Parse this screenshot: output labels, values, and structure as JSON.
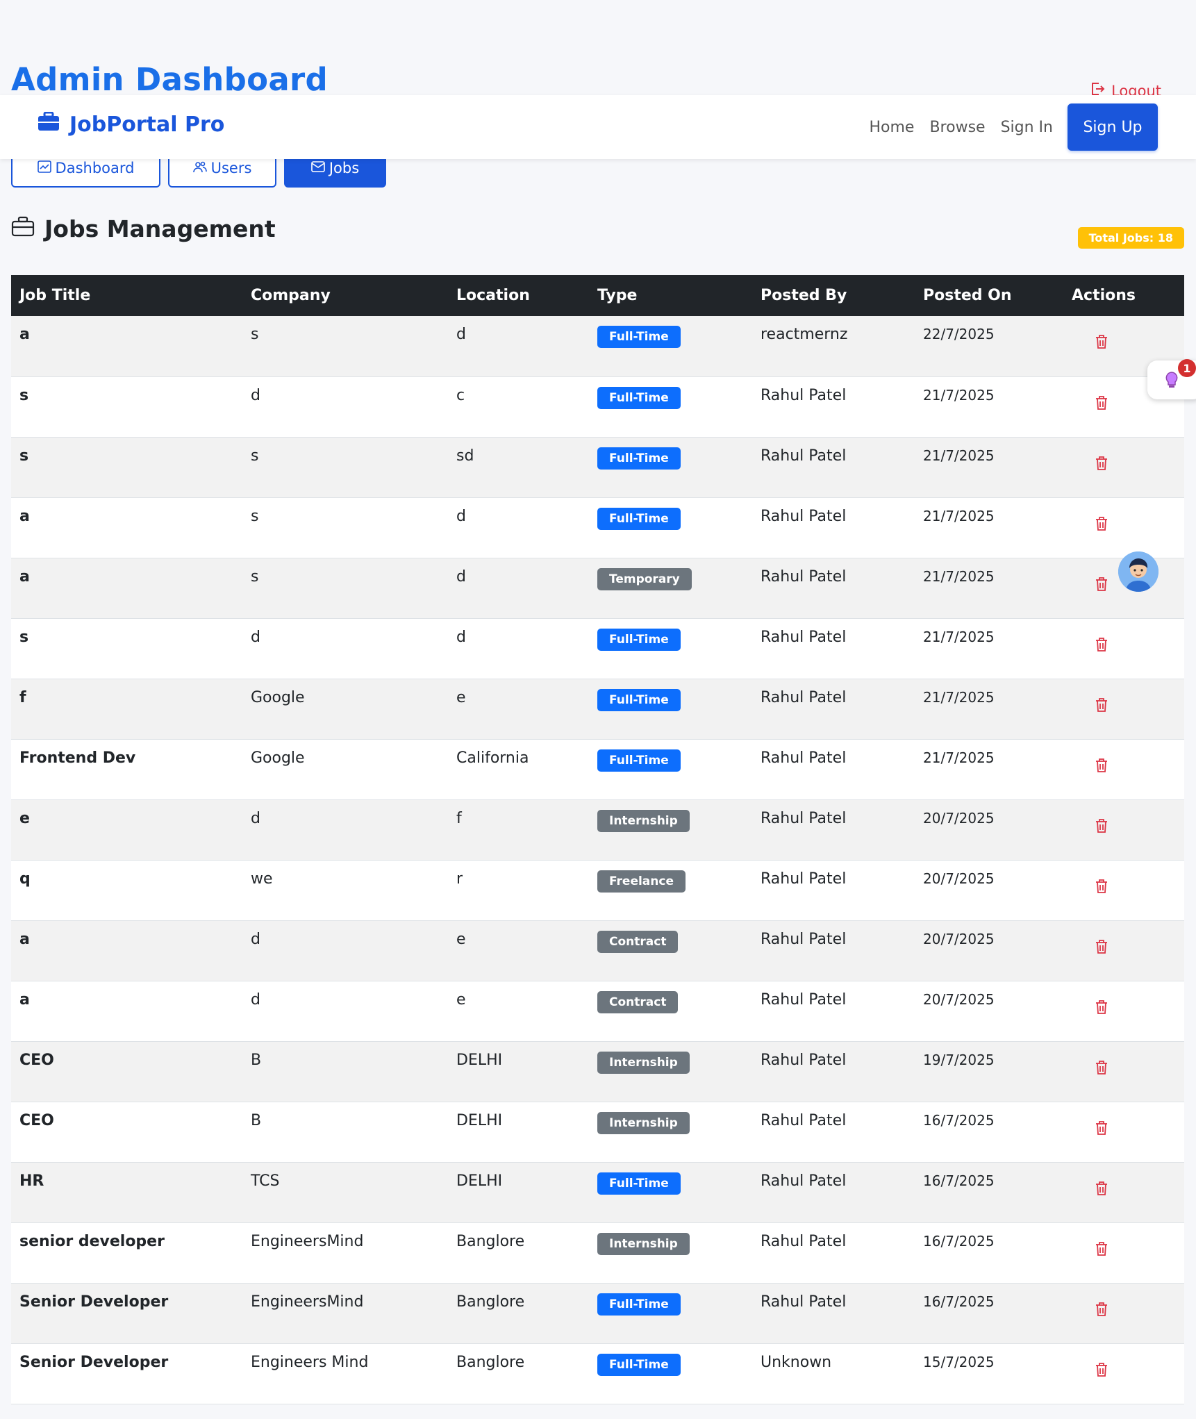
{
  "page": {
    "title": "Admin Dashboard",
    "logout_label": "Logout"
  },
  "navbar": {
    "brand": "JobPortal Pro",
    "links": [
      "Home",
      "Browse",
      "Sign In"
    ],
    "signup_label": "Sign Up"
  },
  "tabs": {
    "dashboard": "Dashboard",
    "users": "Users",
    "jobs": "Jobs"
  },
  "section": {
    "title": "Jobs Management",
    "total_badge": "Total Jobs: 18"
  },
  "floating": {
    "notification_count": "1"
  },
  "colors": {
    "primary": "#1a56db",
    "title_blue": "#1a6fe8",
    "danger": "#dc3545",
    "warning": "#ffc107",
    "badge_blue": "#0d6efd",
    "badge_gray": "#6c757d",
    "table_header": "#212529"
  },
  "table": {
    "headers": [
      "Job Title",
      "Company",
      "Location",
      "Type",
      "Posted By",
      "Posted On",
      "Actions"
    ],
    "rows": [
      {
        "title": "a",
        "company": "s",
        "location": "d",
        "type": "Full-Time",
        "posted_by": "reactmernz",
        "posted_on": "22/7/2025"
      },
      {
        "title": "s",
        "company": "d",
        "location": "c",
        "type": "Full-Time",
        "posted_by": "Rahul Patel",
        "posted_on": "21/7/2025"
      },
      {
        "title": "s",
        "company": "s",
        "location": "sd",
        "type": "Full-Time",
        "posted_by": "Rahul Patel",
        "posted_on": "21/7/2025"
      },
      {
        "title": "a",
        "company": "s",
        "location": "d",
        "type": "Full-Time",
        "posted_by": "Rahul Patel",
        "posted_on": "21/7/2025"
      },
      {
        "title": "a",
        "company": "s",
        "location": "d",
        "type": "Temporary",
        "posted_by": "Rahul Patel",
        "posted_on": "21/7/2025"
      },
      {
        "title": "s",
        "company": "d",
        "location": "d",
        "type": "Full-Time",
        "posted_by": "Rahul Patel",
        "posted_on": "21/7/2025"
      },
      {
        "title": "f",
        "company": "Google",
        "location": "e",
        "type": "Full-Time",
        "posted_by": "Rahul Patel",
        "posted_on": "21/7/2025"
      },
      {
        "title": "Frontend Dev",
        "company": "Google",
        "location": "California",
        "type": "Full-Time",
        "posted_by": "Rahul Patel",
        "posted_on": "21/7/2025"
      },
      {
        "title": "e",
        "company": "d",
        "location": "f",
        "type": "Internship",
        "posted_by": "Rahul Patel",
        "posted_on": "20/7/2025"
      },
      {
        "title": "q",
        "company": "we",
        "location": "r",
        "type": "Freelance",
        "posted_by": "Rahul Patel",
        "posted_on": "20/7/2025"
      },
      {
        "title": "a",
        "company": "d",
        "location": "e",
        "type": "Contract",
        "posted_by": "Rahul Patel",
        "posted_on": "20/7/2025"
      },
      {
        "title": "a",
        "company": "d",
        "location": "e",
        "type": "Contract",
        "posted_by": "Rahul Patel",
        "posted_on": "20/7/2025"
      },
      {
        "title": "CEO",
        "company": "B",
        "location": "DELHI",
        "type": "Internship",
        "posted_by": "Rahul Patel",
        "posted_on": "19/7/2025"
      },
      {
        "title": "CEO",
        "company": "B",
        "location": "DELHI",
        "type": "Internship",
        "posted_by": "Rahul Patel",
        "posted_on": "16/7/2025"
      },
      {
        "title": "HR",
        "company": "TCS",
        "location": "DELHI",
        "type": "Full-Time",
        "posted_by": "Rahul Patel",
        "posted_on": "16/7/2025"
      },
      {
        "title": "senior developer",
        "company": "EngineersMind",
        "location": "Banglore",
        "type": "Internship",
        "posted_by": "Rahul Patel",
        "posted_on": "16/7/2025"
      },
      {
        "title": "Senior Developer",
        "company": "EngineersMind",
        "location": "Banglore",
        "type": "Full-Time",
        "posted_by": "Rahul Patel",
        "posted_on": "16/7/2025"
      },
      {
        "title": "Senior Developer",
        "company": "Engineers Mind",
        "location": "Banglore",
        "type": "Full-Time",
        "posted_by": "Unknown",
        "posted_on": "15/7/2025"
      }
    ]
  }
}
